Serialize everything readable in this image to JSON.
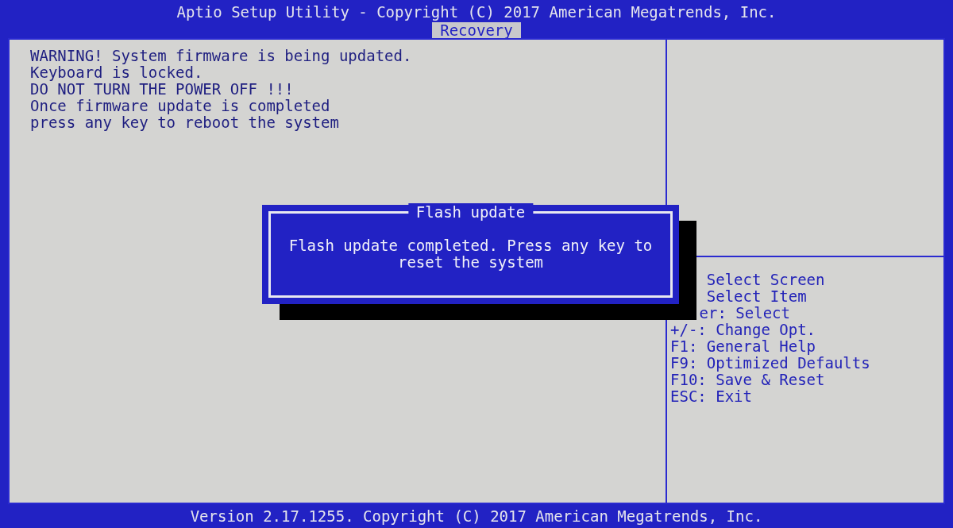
{
  "header": {
    "title": "Aptio Setup Utility - Copyright (C) 2017 American Megatrends, Inc.",
    "tabs": [
      {
        "label": "Recovery",
        "selected": true
      }
    ]
  },
  "main_text": [
    "WARNING! System firmware is being updated.",
    "Keyboard is locked.",
    "DO NOT TURN THE POWER OFF !!!",
    "Once firmware update is completed",
    "press any key to reboot the system"
  ],
  "help": [
    "Select Screen",
    "Select Item",
    "er: Select",
    "+/-: Change Opt.",
    "F1: General Help",
    "F9: Optimized Defaults",
    "F10: Save & Reset",
    "ESC: Exit"
  ],
  "dialog": {
    "title": "Flash update",
    "message": "Flash update completed. Press any key to reset the system"
  },
  "footer": "Version 2.17.1255. Copyright (C) 2017 American Megatrends, Inc."
}
